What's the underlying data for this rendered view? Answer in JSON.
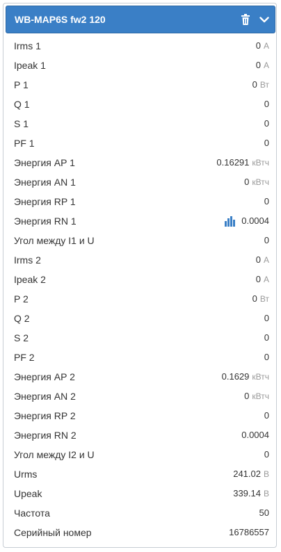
{
  "widget": {
    "title": "WB-MAP6S fw2 120",
    "delete_icon": "trash-icon",
    "collapse_icon": "chevron-down-icon",
    "accent_color": "#3a7fc6",
    "chart_icon": "bar-chart-icon",
    "rows": [
      {
        "label": "Irms 1",
        "value": "0",
        "unit": "A"
      },
      {
        "label": "Ipeak 1",
        "value": "0",
        "unit": "A"
      },
      {
        "label": "P 1",
        "value": "0",
        "unit": "Вт"
      },
      {
        "label": "Q 1",
        "value": "0",
        "unit": ""
      },
      {
        "label": "S 1",
        "value": "0",
        "unit": ""
      },
      {
        "label": "PF 1",
        "value": "0",
        "unit": ""
      },
      {
        "label": "Энергия AP 1",
        "value": "0.16291",
        "unit": "кВтч"
      },
      {
        "label": "Энергия AN 1",
        "value": "0",
        "unit": "кВтч"
      },
      {
        "label": "Энергия RP 1",
        "value": "0",
        "unit": ""
      },
      {
        "label": "Энергия RN 1",
        "value": "0.0004",
        "unit": "",
        "chart": true
      },
      {
        "label": "Угол между I1 и U",
        "value": "0",
        "unit": ""
      },
      {
        "label": "Irms 2",
        "value": "0",
        "unit": "A"
      },
      {
        "label": "Ipeak 2",
        "value": "0",
        "unit": "A"
      },
      {
        "label": "P 2",
        "value": "0",
        "unit": "Вт"
      },
      {
        "label": "Q 2",
        "value": "0",
        "unit": ""
      },
      {
        "label": "S 2",
        "value": "0",
        "unit": ""
      },
      {
        "label": "PF 2",
        "value": "0",
        "unit": ""
      },
      {
        "label": "Энергия AP 2",
        "value": "0.1629",
        "unit": "кВтч"
      },
      {
        "label": "Энергия AN 2",
        "value": "0",
        "unit": "кВтч"
      },
      {
        "label": "Энергия RP 2",
        "value": "0",
        "unit": ""
      },
      {
        "label": "Энергия RN 2",
        "value": "0.0004",
        "unit": ""
      },
      {
        "label": "Угол между I2 и U",
        "value": "0",
        "unit": ""
      },
      {
        "label": "Urms",
        "value": "241.02",
        "unit": "В"
      },
      {
        "label": "Upeak",
        "value": "339.14",
        "unit": "В"
      },
      {
        "label": "Частота",
        "value": "50",
        "unit": ""
      },
      {
        "label": "Серийный номер",
        "value": "16786557",
        "unit": ""
      }
    ]
  }
}
